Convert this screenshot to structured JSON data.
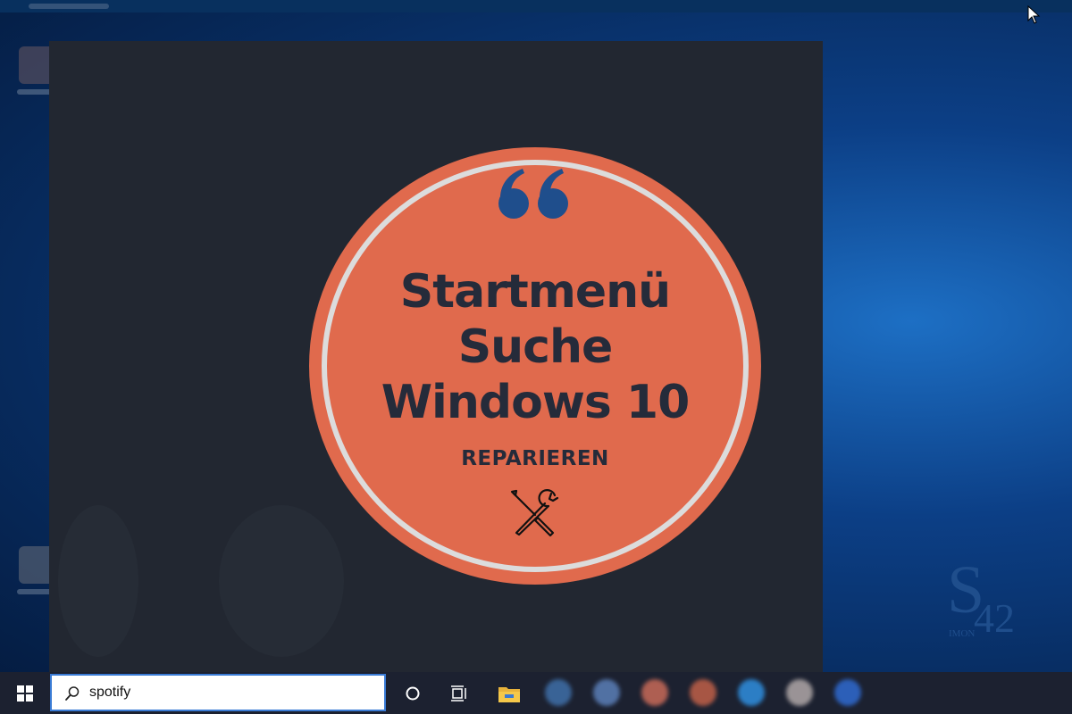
{
  "promo": {
    "title_lines": [
      "Startmenü",
      "Suche",
      "Windows 10"
    ],
    "subtitle": "REPARIEREN"
  },
  "logo": {
    "letter": "S",
    "number": "42",
    "subtext": "IMON"
  },
  "taskbar": {
    "search_value": "spotify",
    "icons": [
      "windows-start-icon",
      "search-icon",
      "cortana-icon",
      "task-view-icon",
      "file-explorer-icon"
    ],
    "pinned_apps": [
      {
        "name": "blurred-app-1",
        "color": "#3f6fa8"
      },
      {
        "name": "blurred-app-2",
        "color": "#5b7fb8"
      },
      {
        "name": "blurred-app-3",
        "color": "#c86a58"
      },
      {
        "name": "blurred-app-4",
        "color": "#c06048"
      },
      {
        "name": "blurred-app-5",
        "color": "#2f8fe0"
      },
      {
        "name": "blurred-app-6",
        "color": "#b0a8a8"
      },
      {
        "name": "blurred-app-7",
        "color": "#2f6ad0"
      }
    ]
  },
  "colors": {
    "badge": "#e06a4d",
    "badge_ring": "#dcdcdc",
    "badge_text": "#252b3a",
    "quote": "#1f4e8c",
    "panel": "#222731",
    "taskbar": "#1c2130",
    "logo": "#1f4e8c"
  }
}
